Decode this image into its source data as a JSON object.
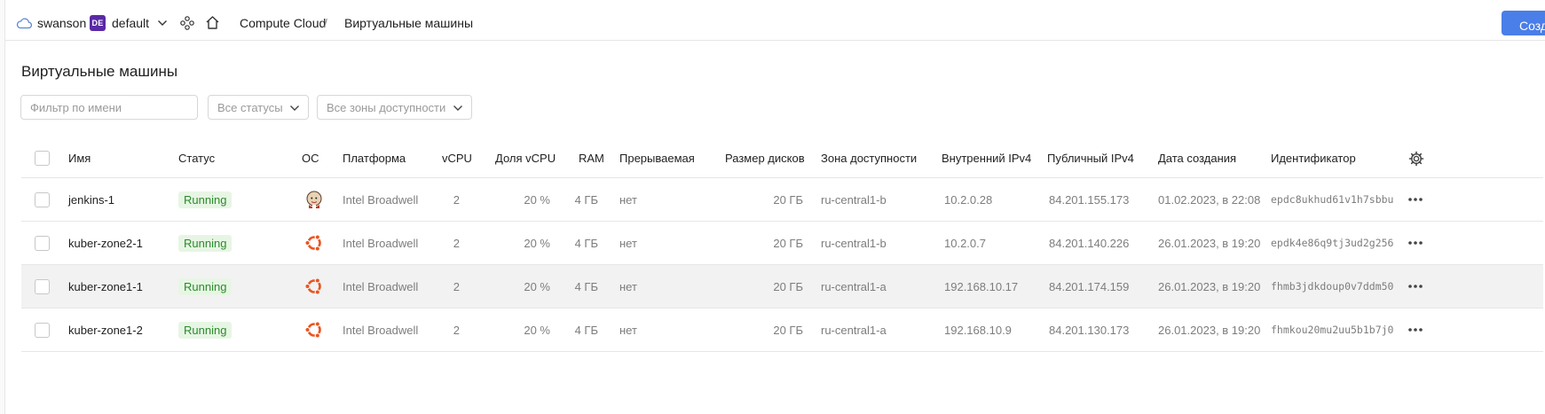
{
  "header": {
    "account": "swanson",
    "folder_badge": "DE",
    "folder": "default",
    "breadcrumb": [
      "Compute Cloud",
      "/",
      "Виртуальные машины"
    ],
    "create_button": "Созд"
  },
  "page_title": "Виртуальные машины",
  "filters": {
    "name_placeholder": "Фильтр по имени",
    "status_select": "Все статусы",
    "zone_select": "Все зоны доступности"
  },
  "table": {
    "columns": [
      "Имя",
      "Статус",
      "ОС",
      "Платформа",
      "vCPU",
      "Доля vCPU",
      "RAM",
      "Прерываемая",
      "Размер дисков",
      "Зона доступности",
      "Внутренний IPv4",
      "Публичный IPv4",
      "Дата создания",
      "Идентификатор"
    ],
    "rows": [
      {
        "name": "jenkins-1",
        "status": "Running",
        "os": "jenkins-icon",
        "platform": "Intel Broadwell",
        "vcpu": "2",
        "core_fraction": "20 %",
        "ram": "4 ГБ",
        "preemptible": "нет",
        "disk": "20 ГБ",
        "zone": "ru-central1-b",
        "internal_ip": "10.2.0.28",
        "public_ip": "84.201.155.173",
        "created": "01.02.2023, в 22:08",
        "id": "epdc8ukhud61v1h7sbbu"
      },
      {
        "name": "kuber-zone2-1",
        "status": "Running",
        "os": "ubuntu-icon",
        "platform": "Intel Broadwell",
        "vcpu": "2",
        "core_fraction": "20 %",
        "ram": "4 ГБ",
        "preemptible": "нет",
        "disk": "20 ГБ",
        "zone": "ru-central1-b",
        "internal_ip": "10.2.0.7",
        "public_ip": "84.201.140.226",
        "created": "26.01.2023, в 19:20",
        "id": "epdk4e86q9tj3ud2g256"
      },
      {
        "name": "kuber-zone1-1",
        "status": "Running",
        "os": "ubuntu-icon",
        "platform": "Intel Broadwell",
        "vcpu": "2",
        "core_fraction": "20 %",
        "ram": "4 ГБ",
        "preemptible": "нет",
        "disk": "20 ГБ",
        "zone": "ru-central1-a",
        "internal_ip": "192.168.10.17",
        "public_ip": "84.201.174.159",
        "created": "26.01.2023, в 19:20",
        "id": "fhmb3jdkdoup0v7ddm50"
      },
      {
        "name": "kuber-zone1-2",
        "status": "Running",
        "os": "ubuntu-icon",
        "platform": "Intel Broadwell",
        "vcpu": "2",
        "core_fraction": "20 %",
        "ram": "4 ГБ",
        "preemptible": "нет",
        "disk": "20 ГБ",
        "zone": "ru-central1-a",
        "internal_ip": "192.168.10.9",
        "public_ip": "84.201.130.173",
        "created": "26.01.2023, в 19:20",
        "id": "fhmkou20mu2uu5b1b7j0"
      }
    ]
  },
  "colors": {
    "accent": "#4a7ee8",
    "folder_badge": "#5a2aa6",
    "status_running_bg": "#e7f6e4",
    "status_running_text": "#2b8a2b",
    "ubuntu": "#e95420"
  }
}
